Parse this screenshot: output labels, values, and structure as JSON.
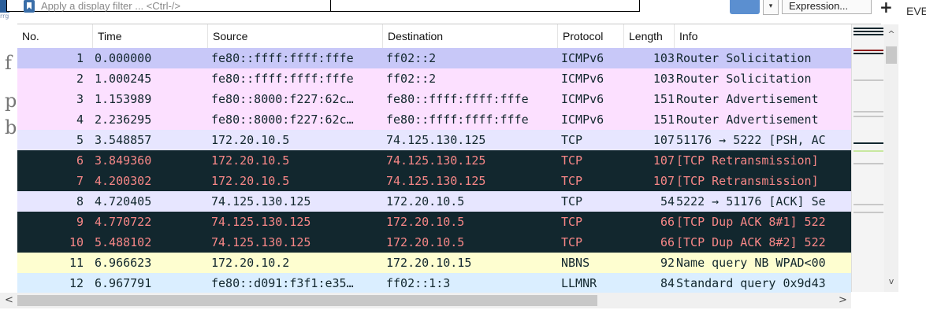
{
  "filter": {
    "placeholder": "Apply a display filter ... <Ctrl-/>",
    "expression_label": "Expression...",
    "plus_label": "+",
    "dropdown_label": "▾",
    "right_edge_text": "EVE",
    "left_icon_label": "rrg"
  },
  "gutter_letters": [
    "f",
    "p",
    "b"
  ],
  "columns": {
    "no": "No.",
    "time": "Time",
    "source": "Source",
    "destination": "Destination",
    "protocol": "Protocol",
    "length": "Length",
    "info": "Info"
  },
  "packets": [
    {
      "no": "1",
      "time": "0.000000",
      "source": "fe80::ffff:ffff:fffe",
      "destination": "ff02::2",
      "protocol": "ICMPv6",
      "length": "103",
      "info": "Router Solicitation",
      "bg": "#c8c8f8",
      "fg": "#12272e"
    },
    {
      "no": "2",
      "time": "1.000245",
      "source": "fe80::ffff:ffff:fffe",
      "destination": "ff02::2",
      "protocol": "ICMPv6",
      "length": "103",
      "info": "Router Solicitation",
      "bg": "#fce0ff",
      "fg": "#12272e"
    },
    {
      "no": "3",
      "time": "1.153989",
      "source": "fe80::8000:f227:62c…",
      "destination": "fe80::ffff:ffff:fffe",
      "protocol": "ICMPv6",
      "length": "151",
      "info": "Router Advertisement",
      "bg": "#fce0ff",
      "fg": "#12272e"
    },
    {
      "no": "4",
      "time": "2.236295",
      "source": "fe80::8000:f227:62c…",
      "destination": "fe80::ffff:ffff:fffe",
      "protocol": "ICMPv6",
      "length": "151",
      "info": "Router Advertisement",
      "bg": "#fce0ff",
      "fg": "#12272e"
    },
    {
      "no": "5",
      "time": "3.548857",
      "source": "172.20.10.5",
      "destination": "74.125.130.125",
      "protocol": "TCP",
      "length": "107",
      "info": "51176 → 5222 [PSH, AC",
      "bg": "#e7e6ff",
      "fg": "#12272e"
    },
    {
      "no": "6",
      "time": "3.849360",
      "source": "172.20.10.5",
      "destination": "74.125.130.125",
      "protocol": "TCP",
      "length": "107",
      "info": "[TCP Retransmission]",
      "bg": "#12272e",
      "fg": "#f78787"
    },
    {
      "no": "7",
      "time": "4.200302",
      "source": "172.20.10.5",
      "destination": "74.125.130.125",
      "protocol": "TCP",
      "length": "107",
      "info": "[TCP Retransmission]",
      "bg": "#12272e",
      "fg": "#f78787"
    },
    {
      "no": "8",
      "time": "4.720405",
      "source": "74.125.130.125",
      "destination": "172.20.10.5",
      "protocol": "TCP",
      "length": "54",
      "info": "5222 → 51176 [ACK] Se",
      "bg": "#e7e6ff",
      "fg": "#12272e"
    },
    {
      "no": "9",
      "time": "4.770722",
      "source": "74.125.130.125",
      "destination": "172.20.10.5",
      "protocol": "TCP",
      "length": "66",
      "info": "[TCP Dup ACK 8#1] 522",
      "bg": "#12272e",
      "fg": "#f78787"
    },
    {
      "no": "10",
      "time": "5.488102",
      "source": "74.125.130.125",
      "destination": "172.20.10.5",
      "protocol": "TCP",
      "length": "66",
      "info": "[TCP Dup ACK 8#2] 522",
      "bg": "#12272e",
      "fg": "#f78787"
    },
    {
      "no": "11",
      "time": "6.966623",
      "source": "172.20.10.2",
      "destination": "172.20.10.15",
      "protocol": "NBNS",
      "length": "92",
      "info": "Name query NB WPAD<00",
      "bg": "#fefed0",
      "fg": "#12272e"
    },
    {
      "no": "12",
      "time": "6.967791",
      "source": "fe80::d091:f3f1:e35…",
      "destination": "ff02::1:3",
      "protocol": "LLMNR",
      "length": "84",
      "info": "Standard query 0x9d43",
      "bg": "#daeeff",
      "fg": "#12272e"
    }
  ],
  "scroll": {
    "up_arrow": "^",
    "down_arrow": "v",
    "left_arrow": "<",
    "right_arrow": ">"
  },
  "colors": {
    "accent": "#5b8fd0",
    "dark_row": "#12272e",
    "dark_row_text": "#f78787"
  }
}
